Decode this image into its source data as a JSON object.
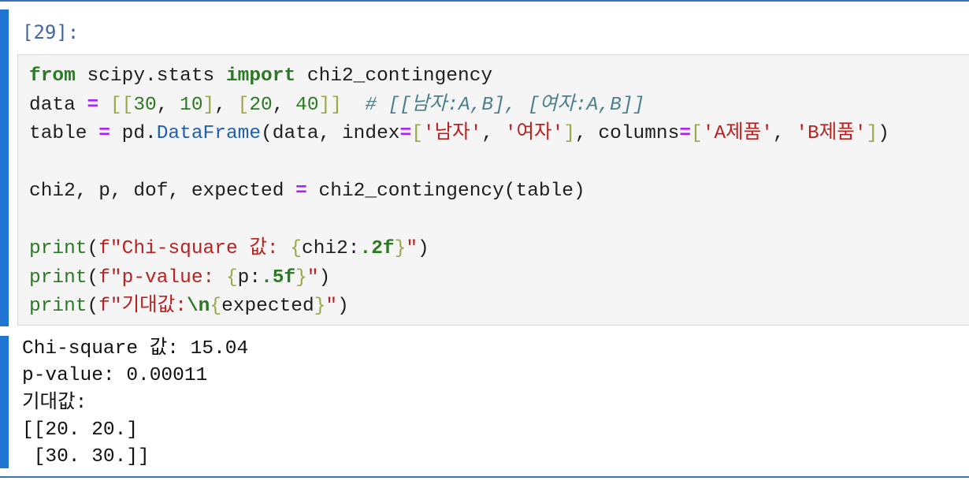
{
  "cell": {
    "prompt": "[29]:",
    "code_lines": [
      [
        {
          "t": "from",
          "c": "kw"
        },
        {
          "t": " scipy.stats ",
          "c": ""
        },
        {
          "t": "import",
          "c": "kw"
        },
        {
          "t": " chi2_contingency",
          "c": ""
        }
      ],
      [
        {
          "t": "data ",
          "c": ""
        },
        {
          "t": "=",
          "c": "op"
        },
        {
          "t": " ",
          "c": ""
        },
        {
          "t": "[[",
          "c": "br"
        },
        {
          "t": "30",
          "c": "num"
        },
        {
          "t": ", ",
          "c": ""
        },
        {
          "t": "10",
          "c": "num"
        },
        {
          "t": "]",
          "c": "br"
        },
        {
          "t": ", ",
          "c": ""
        },
        {
          "t": "[",
          "c": "br"
        },
        {
          "t": "20",
          "c": "num"
        },
        {
          "t": ", ",
          "c": ""
        },
        {
          "t": "40",
          "c": "num"
        },
        {
          "t": "]]",
          "c": "br"
        },
        {
          "t": "  ",
          "c": ""
        },
        {
          "t": "# [[남자:A,B], [여자:A,B]]",
          "c": "cm"
        }
      ],
      [
        {
          "t": "table ",
          "c": ""
        },
        {
          "t": "=",
          "c": "op"
        },
        {
          "t": " pd.",
          "c": ""
        },
        {
          "t": "DataFrame",
          "c": "cls"
        },
        {
          "t": "(data, index",
          "c": ""
        },
        {
          "t": "=",
          "c": "op"
        },
        {
          "t": "[",
          "c": "br"
        },
        {
          "t": "'남자'",
          "c": "str"
        },
        {
          "t": ", ",
          "c": ""
        },
        {
          "t": "'여자'",
          "c": "str"
        },
        {
          "t": "]",
          "c": "br"
        },
        {
          "t": ", columns",
          "c": ""
        },
        {
          "t": "=",
          "c": "op"
        },
        {
          "t": "[",
          "c": "br"
        },
        {
          "t": "'A제품'",
          "c": "str"
        },
        {
          "t": ", ",
          "c": ""
        },
        {
          "t": "'B제품'",
          "c": "str"
        },
        {
          "t": "]",
          "c": "br"
        },
        {
          "t": ")",
          "c": ""
        }
      ],
      [],
      [
        {
          "t": "chi2, p, dof, expected ",
          "c": ""
        },
        {
          "t": "=",
          "c": "op"
        },
        {
          "t": " chi2_contingency(table)",
          "c": ""
        }
      ],
      [],
      [
        {
          "t": "print",
          "c": "fn"
        },
        {
          "t": "(",
          "c": ""
        },
        {
          "t": "f\"Chi-square 값: ",
          "c": "str"
        },
        {
          "t": "{",
          "c": "br"
        },
        {
          "t": "chi2:",
          "c": ""
        },
        {
          "t": ".2f",
          "c": "kfmt"
        },
        {
          "t": "}",
          "c": "br"
        },
        {
          "t": "\"",
          "c": "str"
        },
        {
          "t": ")",
          "c": ""
        }
      ],
      [
        {
          "t": "print",
          "c": "fn"
        },
        {
          "t": "(",
          "c": ""
        },
        {
          "t": "f\"p-value: ",
          "c": "str"
        },
        {
          "t": "{",
          "c": "br"
        },
        {
          "t": "p:",
          "c": ""
        },
        {
          "t": ".5f",
          "c": "kfmt"
        },
        {
          "t": "}",
          "c": "br"
        },
        {
          "t": "\"",
          "c": "str"
        },
        {
          "t": ")",
          "c": ""
        }
      ],
      [
        {
          "t": "print",
          "c": "fn"
        },
        {
          "t": "(",
          "c": ""
        },
        {
          "t": "f\"기대값:",
          "c": "str"
        },
        {
          "t": "\\n",
          "c": "kfmt"
        },
        {
          "t": "{",
          "c": "br"
        },
        {
          "t": "expected",
          "c": ""
        },
        {
          "t": "}",
          "c": "br"
        },
        {
          "t": "\"",
          "c": "str"
        },
        {
          "t": ")",
          "c": ""
        }
      ]
    ],
    "output_lines": [
      "Chi-square 값: 15.04",
      "p-value: 0.00011",
      "기대값:",
      "[[20. 20.]",
      " [30. 30.]]"
    ]
  }
}
